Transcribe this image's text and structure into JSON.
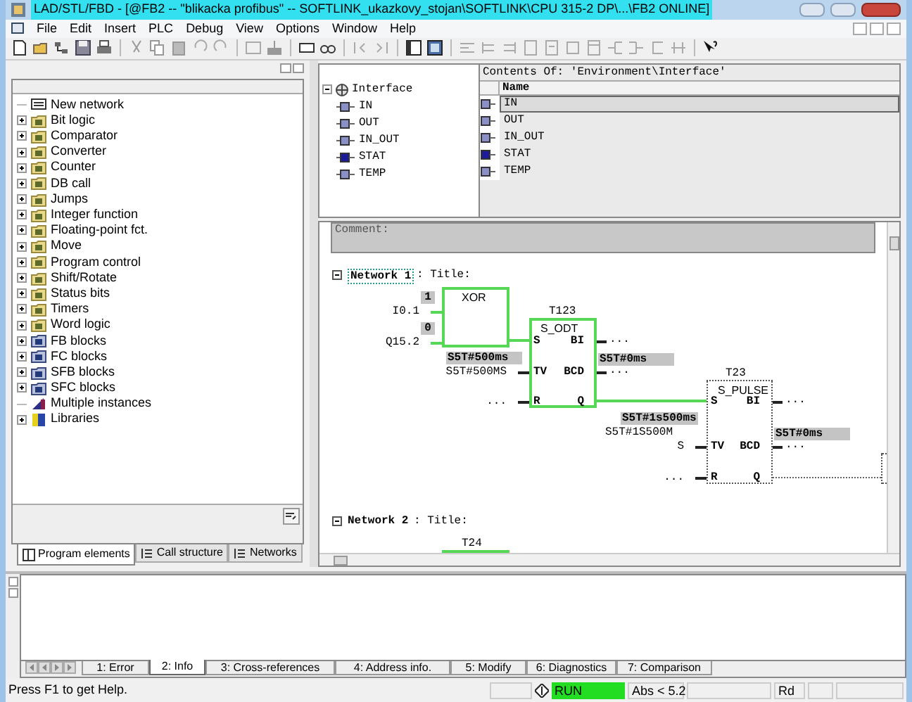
{
  "window": {
    "title": "LAD/STL/FBD  - [@FB2 -- \"blikacka profibus\" -- SOFTLINK_ukazkovy_stojan\\SOFTLINK\\CPU 315-2 DP\\...\\FB2  ONLINE]"
  },
  "menu": [
    "File",
    "Edit",
    "Insert",
    "PLC",
    "Debug",
    "View",
    "Options",
    "Window",
    "Help"
  ],
  "program_elements": [
    {
      "label": "New network",
      "expandable": false,
      "kind": "network"
    },
    {
      "label": "Bit logic",
      "expandable": true,
      "kind": "folder"
    },
    {
      "label": "Comparator",
      "expandable": true,
      "kind": "folder"
    },
    {
      "label": "Converter",
      "expandable": true,
      "kind": "folder"
    },
    {
      "label": "Counter",
      "expandable": true,
      "kind": "folder"
    },
    {
      "label": "DB call",
      "expandable": true,
      "kind": "folder"
    },
    {
      "label": "Jumps",
      "expandable": true,
      "kind": "folder"
    },
    {
      "label": "Integer function",
      "expandable": true,
      "kind": "folder"
    },
    {
      "label": "Floating-point fct.",
      "expandable": true,
      "kind": "folder"
    },
    {
      "label": "Move",
      "expandable": true,
      "kind": "folder"
    },
    {
      "label": "Program control",
      "expandable": true,
      "kind": "folder"
    },
    {
      "label": "Shift/Rotate",
      "expandable": true,
      "kind": "folder"
    },
    {
      "label": "Status bits",
      "expandable": true,
      "kind": "folder"
    },
    {
      "label": "Timers",
      "expandable": true,
      "kind": "folder"
    },
    {
      "label": "Word logic",
      "expandable": true,
      "kind": "folder"
    },
    {
      "label": "FB blocks",
      "expandable": true,
      "kind": "block"
    },
    {
      "label": "FC blocks",
      "expandable": true,
      "kind": "block"
    },
    {
      "label": "SFB blocks",
      "expandable": true,
      "kind": "block"
    },
    {
      "label": "SFC blocks",
      "expandable": true,
      "kind": "block"
    },
    {
      "label": "Multiple instances",
      "expandable": false,
      "kind": "instances"
    },
    {
      "label": "Libraries",
      "expandable": true,
      "kind": "library"
    }
  ],
  "left_tabs": [
    {
      "label": "Program elements",
      "selected": true
    },
    {
      "label": "Call structure",
      "selected": false
    },
    {
      "label": "Networks",
      "selected": false
    }
  ],
  "interface_tree": {
    "label": "Interface",
    "expanded": true,
    "children": [
      {
        "label": "IN"
      },
      {
        "label": "OUT"
      },
      {
        "label": "IN_OUT"
      },
      {
        "label": "STAT"
      },
      {
        "label": "TEMP"
      }
    ]
  },
  "contents": {
    "heading": "Contents Of: 'Environment\\Interface'",
    "column": "Name",
    "rows": [
      {
        "name": "IN",
        "selected": true
      },
      {
        "name": "OUT",
        "selected": false
      },
      {
        "name": "IN_OUT",
        "selected": false
      },
      {
        "name": "STAT",
        "selected": false
      },
      {
        "name": "TEMP",
        "selected": false
      }
    ]
  },
  "comment_label": "Comment:",
  "networks": [
    {
      "label": "Network 1",
      "title": ": Title:",
      "selected": true,
      "blocks": [
        {
          "type": "XOR",
          "active": true,
          "inputs": [
            {
              "operand": "I0.1",
              "value": "1"
            },
            {
              "operand": "Q15.2",
              "value": "0"
            }
          ]
        },
        {
          "instance": "T123",
          "type": "S_ODT",
          "active": true,
          "inputs": [
            {
              "pin": "S"
            },
            {
              "pin": "TV",
              "operand": "S5T#500MS",
              "value": "S5T#500ms"
            },
            {
              "pin": "R",
              "operand": "..."
            }
          ],
          "outputs": [
            {
              "pin": "BI",
              "operand": "..."
            },
            {
              "pin": "BCD",
              "operand": "...",
              "value": "S5T#0ms"
            },
            {
              "pin": "Q"
            }
          ]
        },
        {
          "instance": "T23",
          "type": "S_PULSE",
          "active": false,
          "inputs": [
            {
              "pin": "S"
            },
            {
              "pin": "TV",
              "operand": "S",
              "operand_above": "S5T#1S500M",
              "value": "S5T#1s500ms"
            },
            {
              "pin": "R",
              "operand": "..."
            }
          ],
          "outputs": [
            {
              "pin": "BI",
              "operand": "..."
            },
            {
              "pin": "BCD",
              "operand": "...",
              "value": "S5T#0ms"
            },
            {
              "pin": "Q"
            }
          ]
        },
        {
          "active": false
        }
      ]
    },
    {
      "label": "Network 2",
      "title": ": Title:",
      "selected": false,
      "blocks": [
        {
          "instance": "T24",
          "active": true
        }
      ]
    }
  ],
  "output_tabs": [
    {
      "label": "1: Error",
      "selected": false
    },
    {
      "label": "2: Info",
      "selected": true
    },
    {
      "label": "3: Cross-references",
      "selected": false
    },
    {
      "label": "4: Address info.",
      "selected": false
    },
    {
      "label": "5: Modify",
      "selected": false
    },
    {
      "label": "6: Diagnostics",
      "selected": false
    },
    {
      "label": "7: Comparison",
      "selected": false
    }
  ],
  "status_bar": {
    "help": "Press F1 to get Help.",
    "mode": "RUN",
    "running": true,
    "address": "Abs < 5.2",
    "access": "Rd"
  }
}
